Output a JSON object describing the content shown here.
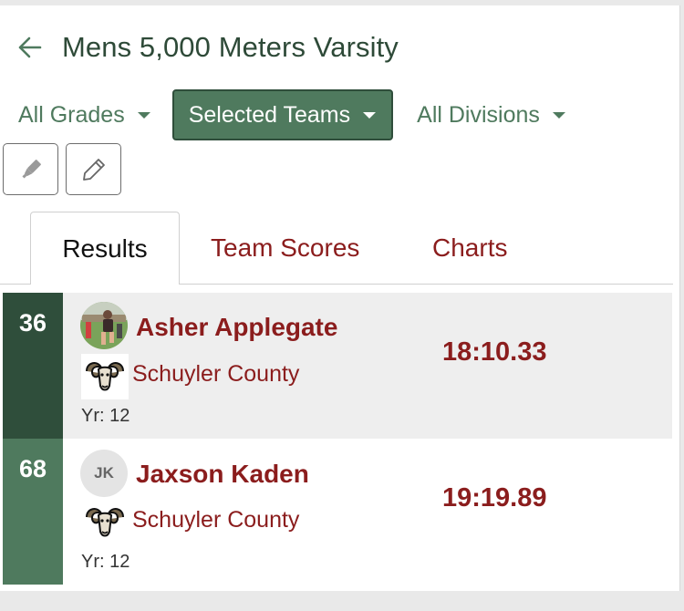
{
  "header": {
    "title": "Mens 5,000 Meters Varsity",
    "back_icon": "arrow-left-icon"
  },
  "filters": {
    "grades": "All Grades",
    "teams": "Selected Teams",
    "divisions": "All Divisions"
  },
  "tools": {
    "highlighter_icon": "highlighter-icon",
    "pencil_icon": "pencil-icon"
  },
  "tabs": [
    {
      "label": "Results",
      "active": true
    },
    {
      "label": "Team Scores",
      "active": false
    },
    {
      "label": "Charts",
      "active": false
    }
  ],
  "results": [
    {
      "place": "36",
      "name": "Asher Applegate",
      "school": "Schuyler County",
      "year": "Yr: 12",
      "time": "18:10.33",
      "avatar": "photo"
    },
    {
      "place": "68",
      "name": "Jaxson Kaden",
      "school": "Schuyler County",
      "year": "Yr: 12",
      "time": "19:19.89",
      "avatar_initials": "JK"
    }
  ],
  "colors": {
    "brand_green": "#4f7a5e",
    "dark_green": "#2f4e3b",
    "accent_red": "#8b1d1d"
  }
}
